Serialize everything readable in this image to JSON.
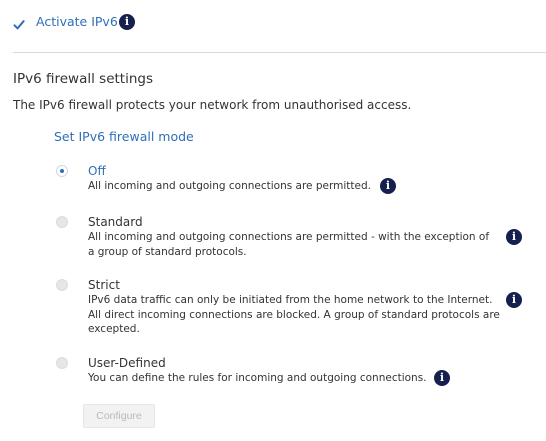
{
  "ipv6": {
    "activate_label": "Activate IPv6",
    "activate_checked": true
  },
  "firewall": {
    "section_title": "IPv6 firewall settings",
    "description": "The IPv6 firewall protects your network from unauthorised access.",
    "mode_title": "Set IPv6 firewall mode",
    "options": [
      {
        "label": "Off",
        "selected": true,
        "desc_lines": [
          "All incoming and outgoing connections are permitted."
        ]
      },
      {
        "label": "Standard",
        "selected": false,
        "desc_lines": [
          "All incoming and outgoing connections are permitted - with the exception of",
          "a group of standard protocols."
        ]
      },
      {
        "label": "Strict",
        "selected": false,
        "desc_lines": [
          "IPv6 data traffic can only be initiated from the home network to the Internet.",
          "All direct incoming connections are blocked. A group of standard protocols are",
          "excepted."
        ]
      },
      {
        "label": "User-Defined",
        "selected": false,
        "desc_lines": [
          "You can define the rules for incoming and outgoing connections."
        ]
      }
    ],
    "configure_label": "Configure"
  },
  "icons": {
    "info_glyph": "i",
    "checkbox": "checkmark-icon",
    "info": "info-icon"
  },
  "colors": {
    "accent": "#2e6fb8",
    "info_bg": "#16204e",
    "text": "#333333",
    "disabled_text": "#b9b9b9"
  }
}
